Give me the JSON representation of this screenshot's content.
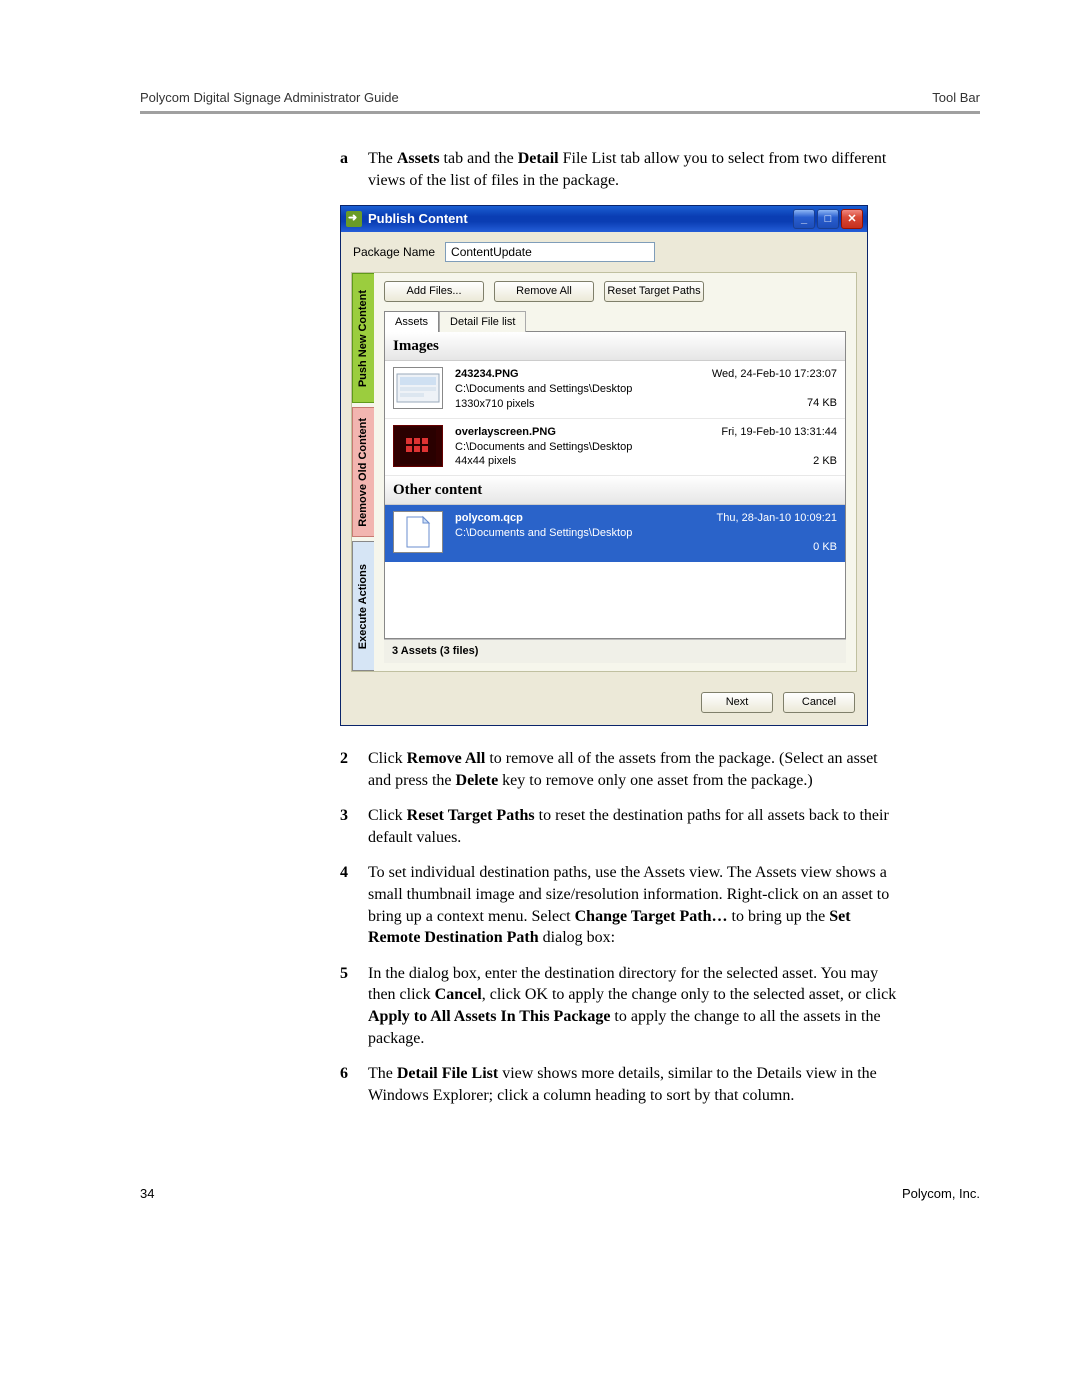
{
  "header": {
    "left": "Polycom Digital Signage Administrator Guide",
    "right": "Tool Bar"
  },
  "steps": {
    "a": {
      "num": "a",
      "pre": "The ",
      "b1": "Assets",
      "mid1": " tab and the ",
      "b2": "Detail",
      "mid2": " File List tab allow you to select from two different views of the list of files in the package."
    },
    "s2": {
      "num": "2",
      "pre": "Click ",
      "b1": "Remove All",
      "mid1": " to remove all of the assets from the package. (Select an asset and press the ",
      "b2": "Delete",
      "mid2": " key to remove only one asset from the package.)"
    },
    "s3": {
      "num": "3",
      "pre": "Click ",
      "b1": "Reset Target Paths",
      "mid1": " to reset the destination paths for all assets back to their default values."
    },
    "s4": {
      "num": "4",
      "pre": "To set individual destination paths, use the Assets view. The Assets view shows a small thumbnail image and size/resolution information. Right-click on an asset to bring up a context menu. Select ",
      "b1": "Change Target Path…",
      "mid1": " to bring up the ",
      "b2": "Set Remote Destination Path",
      "mid2": " dialog box:"
    },
    "s5": {
      "num": "5",
      "pre": "In the dialog box, enter the destination directory for the selected asset. You may then click ",
      "b1": "Cancel",
      "mid1": ", click OK to apply the change only to the selected asset, or click ",
      "b2": "Apply to All Assets In This Package",
      "mid2": " to apply the change to all the assets in the package."
    },
    "s6": {
      "num": "6",
      "pre": "The ",
      "b1": "Detail File List",
      "mid1": " view shows more details, similar to the Details view in the Windows Explorer; click a column heading to sort by that column."
    }
  },
  "window": {
    "title": "Publish Content",
    "package_label": "Package Name",
    "package_value": "ContentUpdate",
    "sidetabs": {
      "push": "Push New Content",
      "remove": "Remove Old Content",
      "exec": "Execute Actions"
    },
    "buttons": {
      "add": "Add Files...",
      "remove_all": "Remove All",
      "reset": "Reset Target Paths"
    },
    "tabs": {
      "assets": "Assets",
      "detail": "Detail File list"
    },
    "groups": {
      "images": "Images",
      "other": "Other content"
    },
    "items": [
      {
        "name": "243234.PNG",
        "path": "C:\\Documents and Settings\\Desktop",
        "dims": "1330x710 pixels",
        "date": "Wed, 24-Feb-10 17:23:07",
        "size": "74 KB"
      },
      {
        "name": "overlayscreen.PNG",
        "path": "C:\\Documents and Settings\\Desktop",
        "dims": "44x44 pixels",
        "date": "Fri, 19-Feb-10 13:31:44",
        "size": "2 KB"
      },
      {
        "name": "polycom.qcp",
        "path": "C:\\Documents and Settings\\Desktop",
        "dims": "",
        "date": "Thu, 28-Jan-10 10:09:21",
        "size": "0 KB"
      }
    ],
    "status": "3 Assets (3 files)",
    "footer": {
      "next": "Next",
      "cancel": "Cancel"
    }
  },
  "page_footer": {
    "num": "34",
    "co": "Polycom, Inc."
  }
}
